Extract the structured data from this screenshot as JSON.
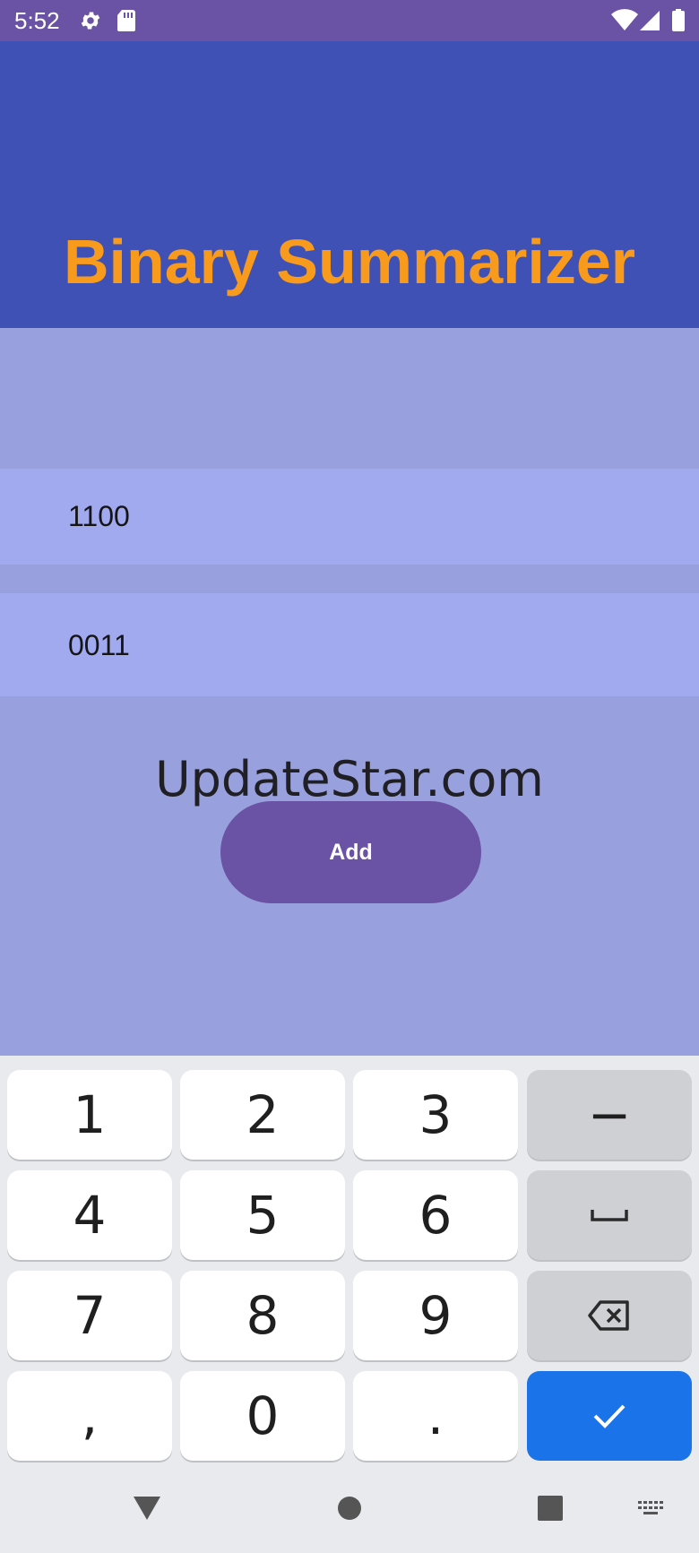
{
  "status_bar": {
    "time": "5:52"
  },
  "app_bar": {
    "title": "Binary Summarizer"
  },
  "inputs": {
    "first_value": "1100",
    "second_value": "0011"
  },
  "watermark": "UpdateStar.com",
  "add_button": {
    "label": "Add"
  },
  "keyboard": {
    "keys": [
      "1",
      "2",
      "3",
      "−",
      "4",
      "5",
      "6",
      "7",
      "8",
      "9",
      ",",
      "0",
      "."
    ]
  },
  "colors": {
    "status_bar": "#6a52a4",
    "app_bar": "#3f51b5",
    "title": "#f89a1c",
    "background": "#98a1dd",
    "input_field": "#a1a9ef",
    "button": "#6a52a4",
    "keyboard_enter": "#1a73e8"
  },
  "icons": {
    "status_bar": [
      "settings-gear-icon",
      "sd-card-icon",
      "wifi-icon",
      "cell-signal-icon",
      "battery-icon"
    ],
    "keyboard": [
      "space-icon",
      "backspace-icon",
      "checkmark-icon"
    ],
    "navbar": [
      "back-triangle-icon",
      "home-circle-icon",
      "recents-square-icon",
      "keyboard-switch-icon"
    ]
  }
}
